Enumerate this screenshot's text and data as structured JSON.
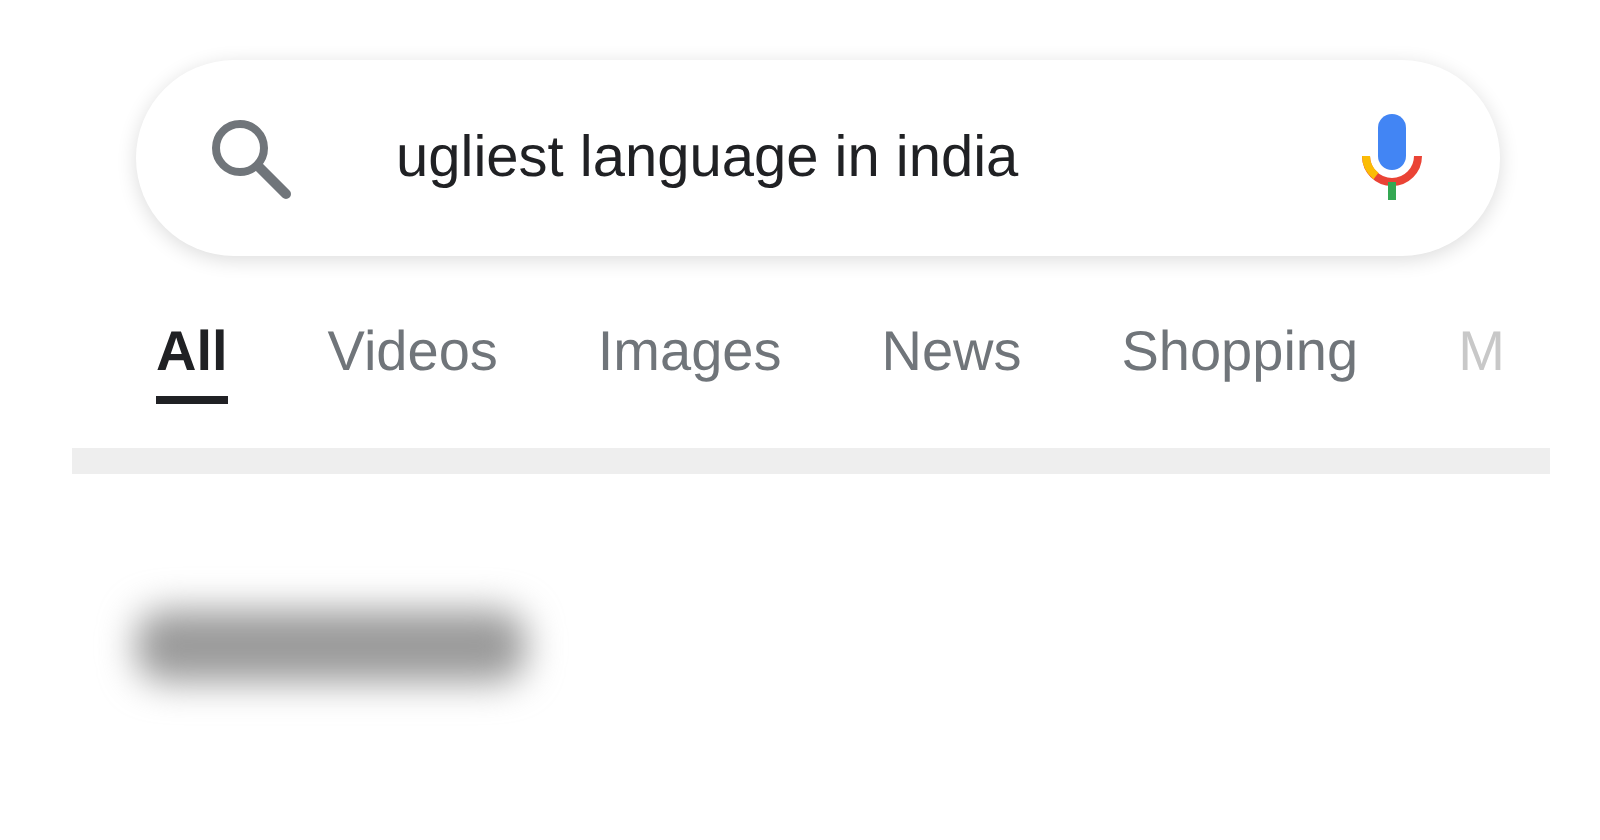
{
  "search": {
    "value": "ugliest language in india"
  },
  "tabs": [
    {
      "label": "All",
      "selected": true
    },
    {
      "label": "Videos",
      "selected": false
    },
    {
      "label": "Images",
      "selected": false
    },
    {
      "label": "News",
      "selected": false
    },
    {
      "label": "Shopping",
      "selected": false
    },
    {
      "label": "M",
      "selected": false
    }
  ]
}
